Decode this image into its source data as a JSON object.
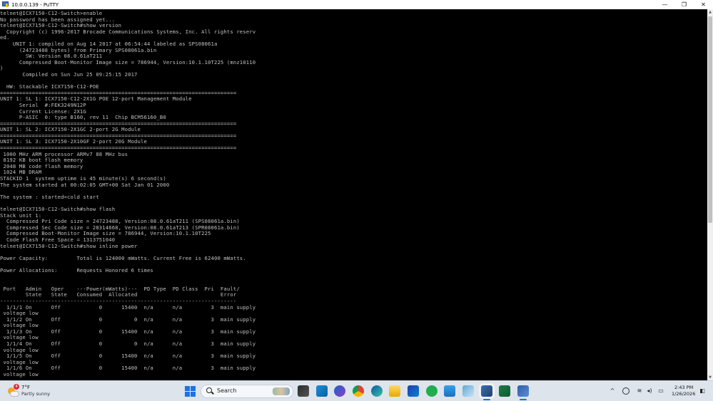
{
  "window": {
    "title": "10.0.0.139 - PuTTY",
    "minimize_glyph": "—",
    "maximize_glyph": "❐",
    "close_glyph": "✕"
  },
  "terminal": {
    "text": "telnet@ICX7150-C12-Switch>enable\nNo password has been assigned yet...\ntelnet@ICX7150-C12-Switch#show version\n  Copyright (c) 1996-2017 Brocade Communications Systems, Inc. All rights reserv\ned.\n    UNIT 1: compiled on Aug 14 2017 at 06:54:44 labeled as SPS08061a\n      (24723488 bytes) from Primary SPS08061a.bin\n        SW: Version 08.0.61aT211\n      Compressed Boot-Monitor Image size = 786944, Version:10.1.10T225 (mnz10110\n)\n       Compiled on Sun Jun 25 09:25:15 2017\n\n  HW: Stackable ICX7150-C12-POE\n==========================================================================\nUNIT 1: SL 1: ICX7150-C12-2X1G POE 12-port Management Module\n      Serial  #:FEK3249N12P\n      Current License: 2X1G\n      P-ASIC  0: type B160, rev 11  Chip BCM56160_B0\n==========================================================================\nUNIT 1: SL 2: ICX7150-2X1GC 2-port 2G Module\n==========================================================================\nUNIT 1: SL 3: ICX7150-2X10GF 2-port 20G Module\n==========================================================================\n 1000 MHz ARM processor ARMv7 88 MHz bus\n 8192 KB boot flash memory\n 2048 MB code flash memory\n 1024 MB DRAM\nSTACKID 1  system uptime is 45 minute(s) 6 second(s)\nThe system started at 00:02:05 GMT+00 Sat Jan 01 2000\n\nThe system : started=cold start\n\ntelnet@ICX7150-C12-Switch#show flash\nStack unit 1:\n  Compressed Pri Code size = 24723488, Version:08.0.61aT211 (SPS08061a.bin)\n  Compressed Sec Code size = 28314668, Version:08.0.61aT213 (SPR08061a.bin)\n  Compressed Boot-Monitor Image size = 786944, Version:10.1.10T225\n  Code Flash Free Space = 1313751040\ntelnet@ICX7150-C12-Switch#show inline power\n\nPower Capacity:         Total is 124000 mWatts. Current Free is 62400 mWatts.\n\nPower Allocations:      Requests Honored 6 times\n\n\n Port   Admin   Oper    ---Power(mWatts)---  PD Type  PD Class  Pri  Fault/\n        State   State   Consumed  Allocated                          Error\n--------------------------------------------------------------------------\n  1/1/1 On      Off            0      15400  n/a      n/a         3  main supply\n voltage low\n  1/1/2 On      Off            0          0  n/a      n/a         3  main supply\n voltage low\n  1/1/3 On      Off            0      15400  n/a      n/a         3  main supply\n voltage low\n  1/1/4 On      Off            0          0  n/a      n/a         3  main supply\n voltage low\n  1/1/5 On      Off            0      15400  n/a      n/a         3  main supply\n voltage low\n  1/1/6 On      Off            0      15400  n/a      n/a         3  main supply\n voltage low",
    "foreground_color": "#c0c0c0",
    "background_color": "#000000"
  },
  "scrollbar": {
    "up_glyph": "▲",
    "down_glyph": "▼"
  },
  "taskbar": {
    "weather": {
      "temperature": "7°F",
      "condition": "Partly sunny",
      "badge": "4"
    },
    "search": {
      "label": "Search"
    },
    "pinned_apps": [
      "file-explorer-icon",
      "monitor-app-icon",
      "copilot-icon",
      "chrome-icon",
      "edge-icon",
      "folder-icon",
      "store-icon",
      "whatsapp-icon",
      "notepad-icon",
      "snipping-tool-icon",
      "putty-icon",
      "excel-icon",
      "network-tool-icon"
    ],
    "tray": {
      "chevron_glyph": "^",
      "wifi_glyph": "≋",
      "volume_glyph": "◂)",
      "battery_glyph": "▭"
    },
    "clock": {
      "time": "2:43 PM",
      "date": "1/26/2026"
    },
    "notification_glyph": "◧"
  }
}
